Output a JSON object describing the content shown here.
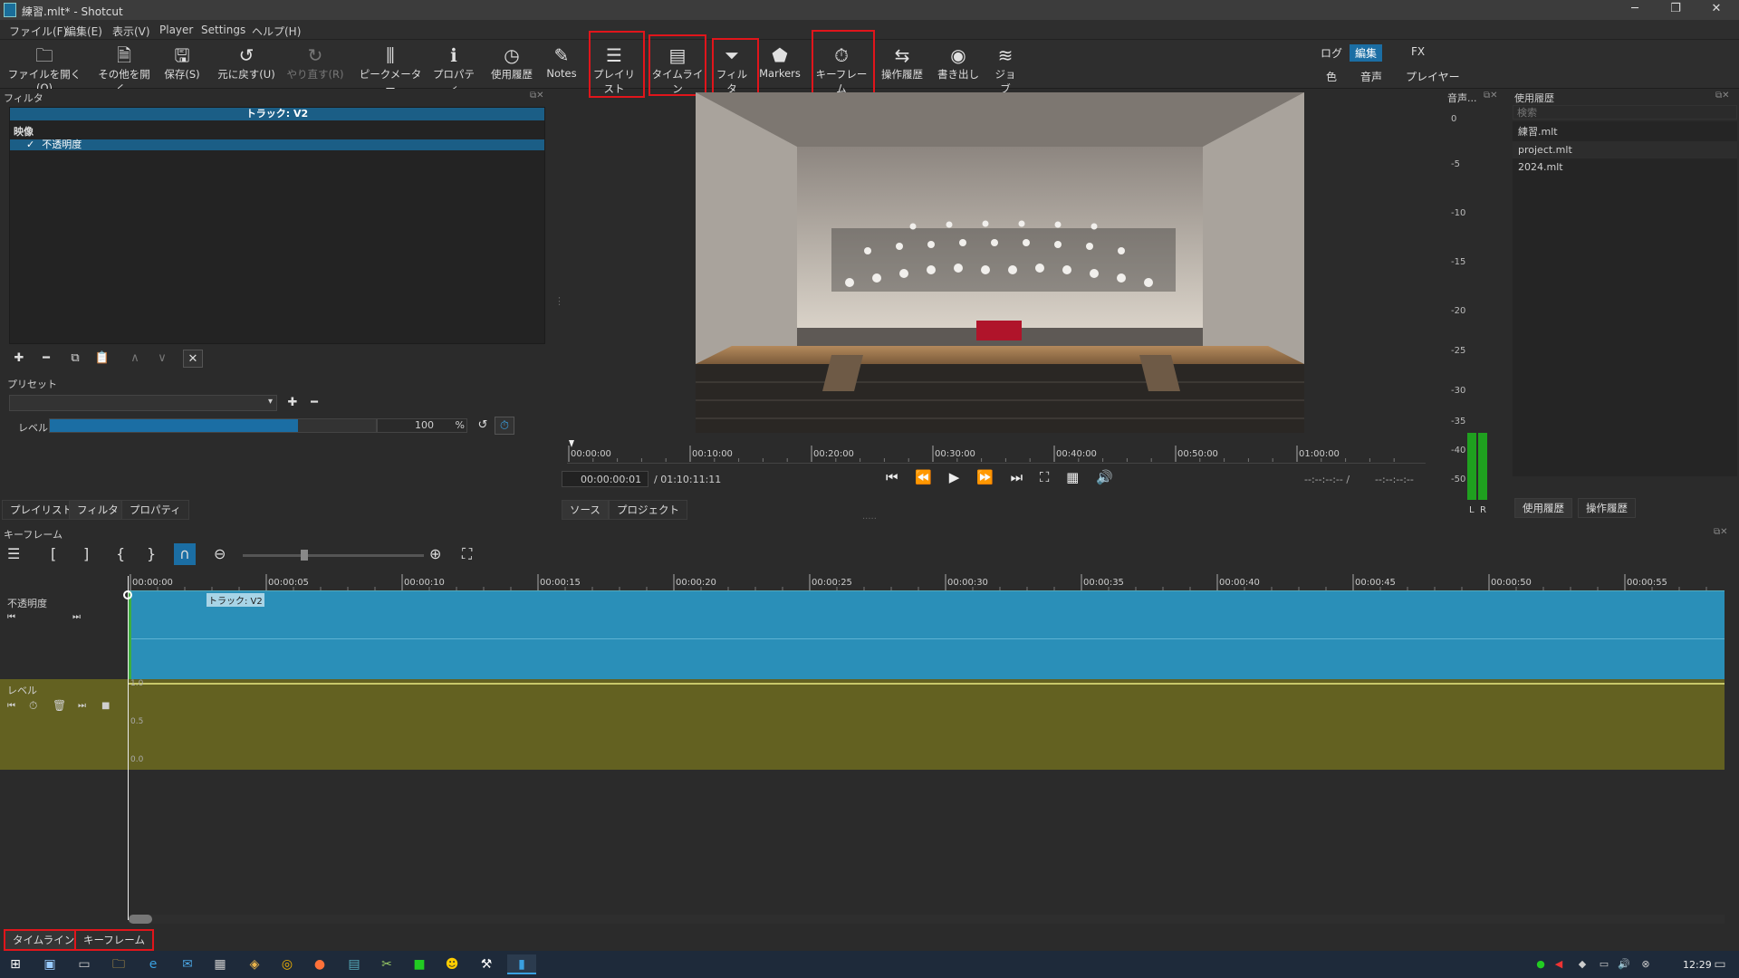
{
  "window": {
    "title": "練習.mlt* - Shotcut"
  },
  "menu": [
    "ファイル(F)",
    "編集(E)",
    "表示(V)",
    "Player",
    "Settings",
    "ヘルプ(H)"
  ],
  "toolbar": {
    "items": [
      {
        "label": "ファイルを開く(O)",
        "icon": "folder-open-icon"
      },
      {
        "label": "その他を開く..",
        "icon": "open-other-icon"
      },
      {
        "label": "保存(S)",
        "icon": "save-icon"
      },
      {
        "label": "元に戻す(U)",
        "icon": "undo-icon"
      },
      {
        "label": "やり直す(R)",
        "icon": "redo-icon"
      },
      {
        "label": "ピークメーター",
        "icon": "peak-meter-icon"
      },
      {
        "label": "プロパティ",
        "icon": "info-icon"
      },
      {
        "label": "使用履歴",
        "icon": "clock-icon"
      },
      {
        "label": "Notes",
        "icon": "notes-icon"
      },
      {
        "label": "プレイリスト",
        "icon": "list-icon"
      },
      {
        "label": "タイムライン",
        "icon": "timeline-icon"
      },
      {
        "label": "フィルタ",
        "icon": "filter-icon"
      },
      {
        "label": "Markers",
        "icon": "marker-icon"
      },
      {
        "label": "キーフレーム",
        "icon": "stopwatch-icon"
      },
      {
        "label": "操作履歴",
        "icon": "history-icon"
      },
      {
        "label": "書き出し",
        "icon": "export-icon"
      },
      {
        "label": "ジョブ",
        "icon": "jobs-icon"
      }
    ],
    "workspaces": [
      "ログ",
      "編集",
      "FX",
      "色",
      "音声",
      "プレイヤー"
    ]
  },
  "filters": {
    "panel_title": "フィルタ",
    "track_label": "トラック: V2",
    "category": "映像",
    "filter_item": "不透明度",
    "preset_label": "プリセット",
    "level_label": "レベル",
    "level_value": "100",
    "level_unit": "%",
    "level_fraction": 1.0,
    "tabs": [
      "プレイリスト",
      "フィルタ",
      "プロパティ"
    ]
  },
  "player": {
    "timecode": "00:00:00:01",
    "duration": "/ 01:10:11:11",
    "in_out_left": "--:--:--:-- /",
    "in_out_right": "--:--:--:--",
    "ruler": [
      "00:00:00",
      "00:10:00",
      "00:20:00",
      "00:30:00",
      "00:40:00",
      "00:50:00",
      "01:00:00"
    ],
    "tabs": [
      "ソース",
      "プロジェクト"
    ]
  },
  "audio_meter": {
    "title": "音声...",
    "scale": [
      "0",
      "-5",
      "-10",
      "-15",
      "-20",
      "-25",
      "-30",
      "-35",
      "-40",
      "-50"
    ],
    "channels": [
      "L",
      "R"
    ]
  },
  "recent": {
    "title": "使用履歴",
    "search_placeholder": "検索",
    "files": [
      "練習.mlt",
      "project.mlt",
      "2024.mlt"
    ],
    "tabs": [
      "使用履歴",
      "操作履歴"
    ]
  },
  "keyframes": {
    "panel_title": "キーフレーム",
    "ruler": [
      "00:00:00",
      "00:00:05",
      "00:00:10",
      "00:00:15",
      "00:00:20",
      "00:00:25",
      "00:00:30",
      "00:00:35",
      "00:00:40",
      "00:00:45",
      "00:00:50",
      "00:00:55"
    ],
    "track1_label": "不透明度",
    "clip_label": "トラック: V2",
    "track2_label": "レベル",
    "level_scale": [
      "1.0",
      "0.5",
      "0.0"
    ]
  },
  "bottom_tabs": [
    "タイムライン",
    "キーフレーム"
  ],
  "taskbar": {
    "time": "12:29"
  },
  "colors": {
    "accent": "#1b6ea4",
    "clip": "#2a8fb8",
    "param": "#636121",
    "highlight": "#e0151b"
  }
}
